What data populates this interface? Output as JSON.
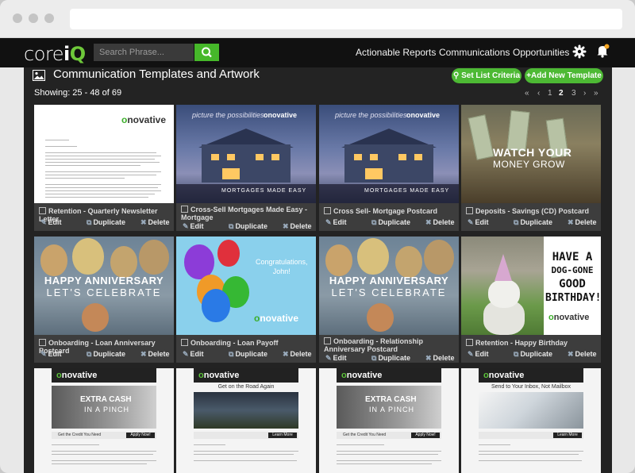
{
  "header": {
    "logo_core": "core",
    "logo_i": "i",
    "logo_q": "Q",
    "search_placeholder": "Search Phrase...",
    "nav": [
      "Actionable Reports",
      "Communications",
      "Opportunities"
    ]
  },
  "page": {
    "title": "Communication Templates and Artwork",
    "set_criteria": "Set List Criteria",
    "add_template": "+Add New Template",
    "showing": "Showing: 25 - 48 of 69",
    "pagination": [
      "«",
      "‹",
      "1",
      "2",
      "3",
      "›",
      "»"
    ],
    "current_page": "2"
  },
  "actions": {
    "edit": "Edit",
    "duplicate": "Duplicate",
    "delete": "Delete"
  },
  "brand": {
    "accent": "#4db934",
    "logo_o": "o",
    "logo_rest": "novative",
    "nav_bg": "#111111",
    "main_bg": "#232323",
    "card_bg": "#3d3d3d"
  },
  "thumbs": {
    "picture": "picture the possibilities",
    "mortgages": "MORTGAGES MADE EASY",
    "watch": "WATCH YOUR",
    "money": "MONEY GROW",
    "happy": "HAPPY ANNIVERSARY",
    "celebrate": "LET'S CELEBRATE",
    "congrats": "Congratulations,",
    "john": "John!",
    "have": "HAVE A",
    "doggone": "DOG-GONE",
    "good": "GOOD",
    "birthday": "BIRTHDAY!",
    "extra": "EXTRA CASH",
    "pinch": "IN A PINCH",
    "get_credit": "Get the Credit You Need",
    "apply": "Apply Now!",
    "get_road": "Get on the Road Again",
    "learn_more": "Learn More",
    "send_inbox": "Send to Your Inbox, Not Mailbox"
  },
  "templates": [
    {
      "name": "Retention - Quarterly Newsletter Letter"
    },
    {
      "name": "Cross-Sell Mortgages Made Easy - Mortgage"
    },
    {
      "name": "Cross Sell- Mortgage Postcard"
    },
    {
      "name": "Deposits - Savings (CD) Postcard"
    },
    {
      "name": "Onboarding - Loan Anniversary Postcard"
    },
    {
      "name": "Onboarding - Loan Payoff"
    },
    {
      "name": "Onboarding - Relationship Anniversary Postcard"
    },
    {
      "name": "Retention - Happy Birthday"
    }
  ]
}
